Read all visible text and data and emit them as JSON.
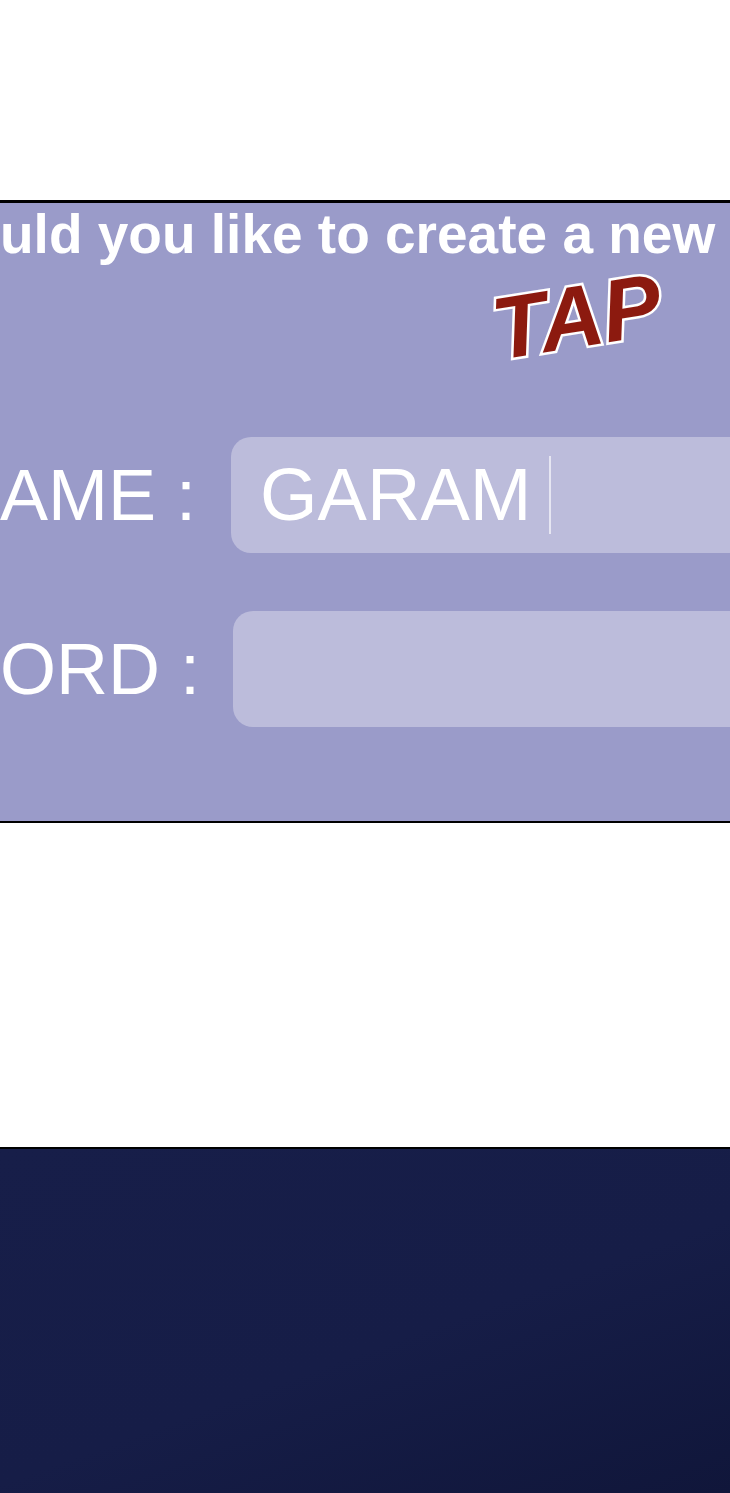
{
  "prompt": "uld you like to create a new",
  "sound_effect": "TAP",
  "fields": [
    {
      "label": "AME :",
      "value": "GARAM",
      "focused": true
    },
    {
      "label": "ORD :",
      "focused": false
    }
  ]
}
